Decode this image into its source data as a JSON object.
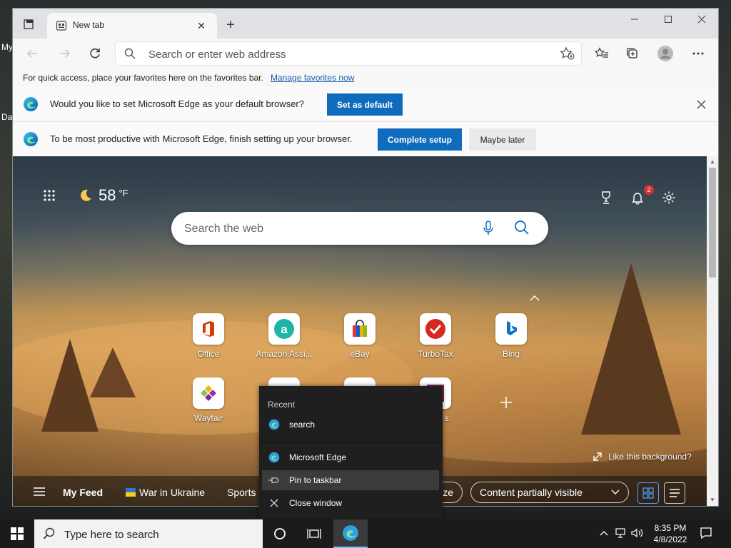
{
  "desktop": {
    "icon_label_1": "My",
    "icon_label_2": "Da"
  },
  "browser": {
    "tab_title": "New tab",
    "new_tab_symbol": "+",
    "close_tab_symbol": "✕",
    "address_placeholder": "Search or enter web address",
    "favorites_bar": {
      "message": "For quick access, place your favorites here on the favorites bar.",
      "link": "Manage favorites now"
    },
    "default_prompt": {
      "message": "Would you like to set Microsoft Edge as your default browser?",
      "button": "Set as default"
    },
    "setup_prompt": {
      "message": "To be most productive with Microsoft Edge, finish setting up your browser.",
      "primary_button": "Complete setup",
      "secondary_button": "Maybe later"
    }
  },
  "new_tab_page": {
    "weather": {
      "temp": "58",
      "unit": "°F"
    },
    "notification_count": "2",
    "search_placeholder": "Search the web",
    "quick_links": [
      {
        "label": "Office"
      },
      {
        "label": "Amazon Assi..."
      },
      {
        "label": "eBay"
      },
      {
        "label": "TurboTax"
      },
      {
        "label": "Bing"
      },
      {
        "label": "Wayfair"
      }
    ],
    "like_background": "Like this background?",
    "feed": {
      "my_feed": "My Feed",
      "ukraine": "War in Ukraine",
      "sports": "Sports",
      "personalize_partial": "lize",
      "content_visibility": "Content partially visible"
    }
  },
  "jump_list": {
    "recent_header": "Recent",
    "recent_item": "search",
    "app_name": "Microsoft Edge",
    "pin": "Pin to taskbar",
    "close": "Close window",
    "partial_label": "s"
  },
  "taskbar": {
    "search_placeholder": "Type here to search",
    "time": "8:35 PM",
    "date": "4/8/2022"
  },
  "colors": {
    "accent": "#0f6cbd",
    "taskbar": "#1b1b1b",
    "jump_bg": "#1f1f1f"
  }
}
